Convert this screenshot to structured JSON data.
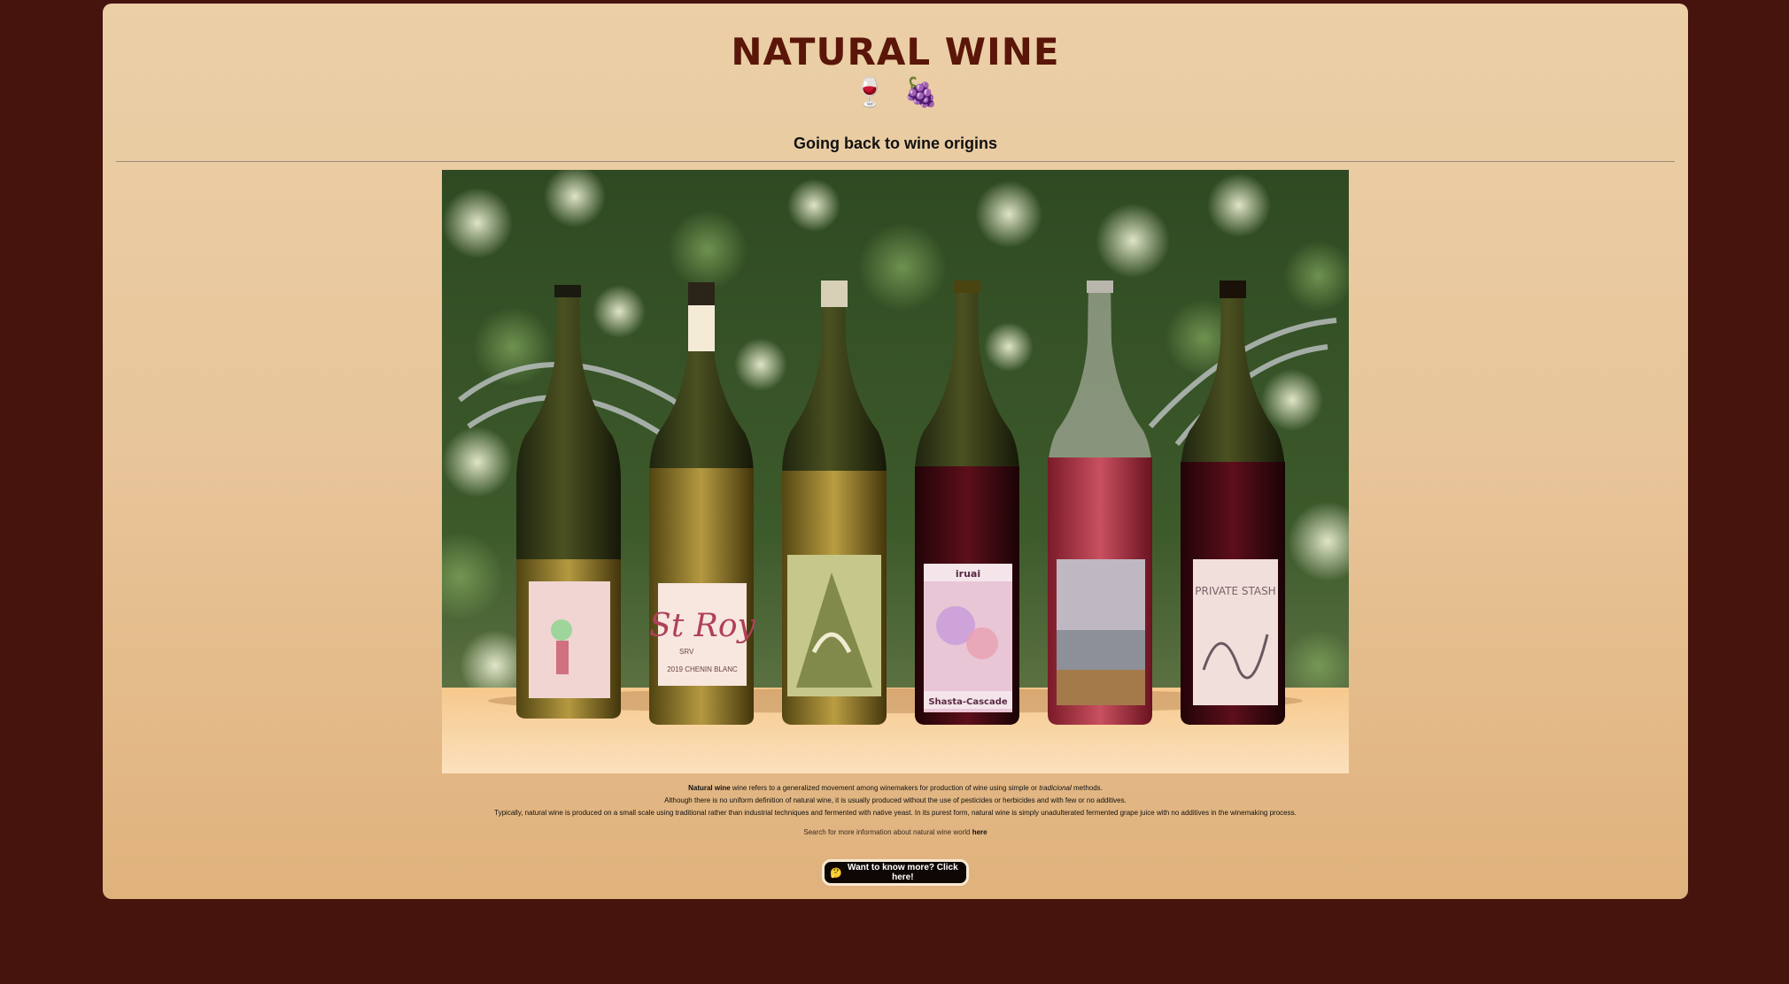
{
  "page": {
    "title": "NATURAL WINE",
    "emojis": [
      "🍷",
      "🍇"
    ],
    "subtitle": "Going back to wine origins"
  },
  "hero_image": {
    "alt": "",
    "bottle_labels": [
      "",
      "St Roy",
      "",
      "iruai",
      "",
      "PRIVATE STASH"
    ],
    "bottle_sublabels": [
      "",
      "SRV",
      "2019 CHENIN BLANC",
      "Shasta-Cascade",
      "",
      ""
    ]
  },
  "description": {
    "line1_bold": "Natural wine",
    "line1_rest_a": " wine refers to a generalized movement among winemakers for production of wine using simple or ",
    "line1_italic": "tradicional",
    "line1_rest_b": " methods.",
    "line2": "Although there is no uniform definition of natural wine, it is usually produced without the use of pesticides or herbicides and with few or no additives.",
    "line3": "Typically, natural wine is produced on a small scale using traditional rather than industrial techniques and fermented with native yeast. In its purest form, natural wine is simply unadulterated fermented grape juice with no additives in the winemaking process."
  },
  "search": {
    "text": "Search for more information about natural wine world ",
    "link": "here"
  },
  "cta": {
    "icon": "🤔",
    "label": "Want to know more? Click here!"
  },
  "colors": {
    "background": "#46130d",
    "card_top": "#ebcfa7",
    "card_bottom": "#e0b27c",
    "title": "#5a1608",
    "button": "#0e0704"
  }
}
